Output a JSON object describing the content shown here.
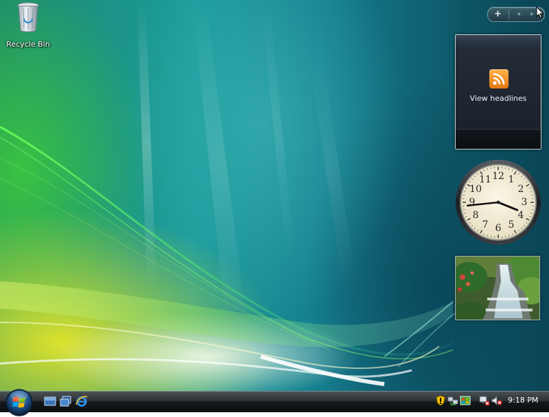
{
  "desktop": {
    "icons": [
      {
        "label": "Recycle Bin",
        "icon": "recycle-bin-icon"
      }
    ]
  },
  "sidebar": {
    "controls": {
      "add_glyph": "+",
      "prev_glyph": "◂",
      "next_glyph": "▸"
    },
    "feed_gadget": {
      "label": "View headlines",
      "icon": "rss-feed-icon",
      "accent": "#f7931e"
    },
    "clock_gadget": {
      "numbers": [
        "12",
        "1",
        "2",
        "3",
        "4",
        "5",
        "6",
        "7",
        "8",
        "9",
        "10",
        "11"
      ],
      "hour": 3,
      "minute": 44
    },
    "slideshow_gadget": {
      "content": "waterfall-photo"
    }
  },
  "taskbar": {
    "quick_launch": [
      {
        "name": "show-desktop",
        "icon": "show-desktop-icon"
      },
      {
        "name": "switch-windows",
        "icon": "switch-windows-icon"
      },
      {
        "name": "internet-explorer",
        "icon": "internet-explorer-icon"
      }
    ],
    "tray": {
      "icons": [
        "security-shield-icon",
        "network-icon",
        "windows-defender-icon",
        "network-disconnected-icon",
        "volume-muted-icon"
      ],
      "time": "9:18 PM"
    }
  }
}
